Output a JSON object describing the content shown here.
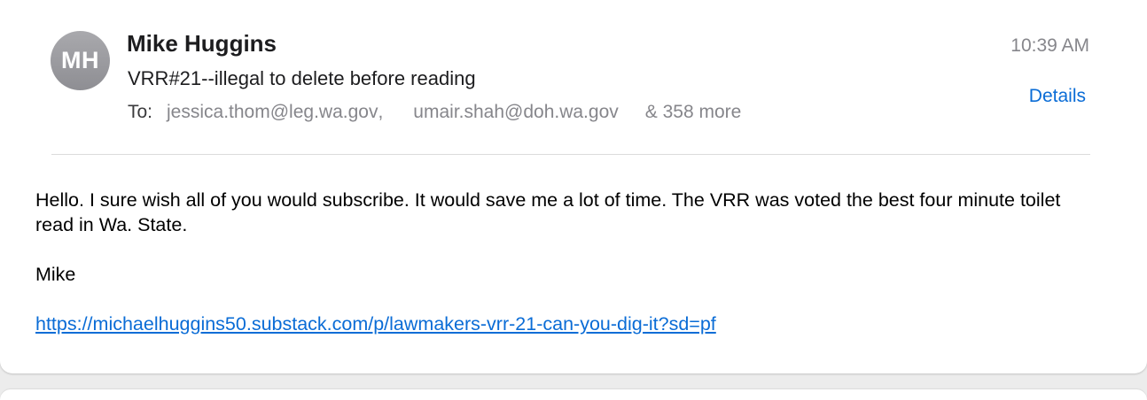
{
  "message": {
    "avatar_initials": "MH",
    "sender_name": "Mike Huggins",
    "subject": "VRR#21--illegal to delete before reading",
    "to_label": "To:",
    "recipients": [
      "jessica.thom@leg.wa.gov",
      "umair.shah@doh.wa.gov"
    ],
    "recipient_separator": ",",
    "more_recipients": "& 358 more",
    "time": "10:39 AM",
    "details_label": "Details",
    "body": {
      "paragraph": "Hello. I sure wish all of you would subscribe. It would save me a lot of time. The VRR was voted the best four minute toilet read in Wa. State.",
      "signoff": "Mike",
      "link": "https://michaelhuggins50.substack.com/p/lawmakers-vrr-21-can-you-dig-it?sd=pf"
    }
  },
  "colors": {
    "accent": "#0a6cd6",
    "secondary_text": "#86868b",
    "avatar_bg": "#9a9aa0"
  }
}
